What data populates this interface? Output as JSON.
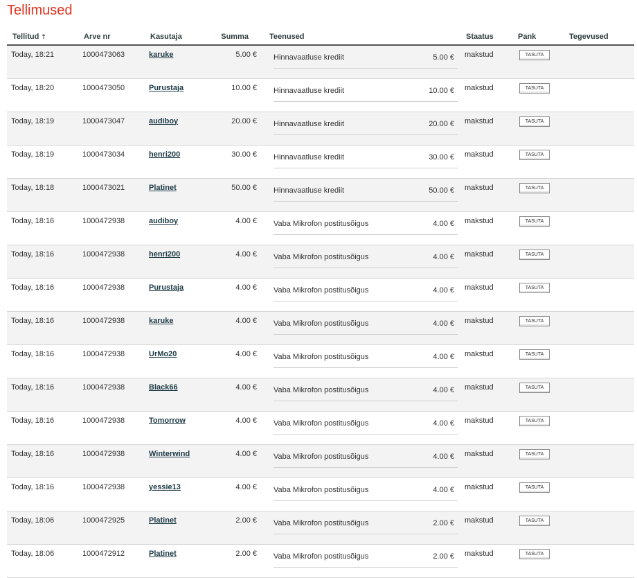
{
  "page": {
    "title": "Tellimused"
  },
  "columns": {
    "ordered": "Tellitud",
    "invoice": "Arve nr",
    "user": "Kasutaja",
    "sum": "Summa",
    "services": "Teenused",
    "status": "Staatus",
    "bank": "Pank",
    "actions": "Tegevused"
  },
  "rows": [
    {
      "date": "Today, 18:21",
      "invoice": "1000473063",
      "user": "karuke",
      "sum": "5.00 €",
      "service": "Hinnavaatluse krediit",
      "service_price": "5.00 €",
      "status": "makstud",
      "pay_label": "TASUTA"
    },
    {
      "date": "Today, 18:20",
      "invoice": "1000473050",
      "user": "Purustaja",
      "sum": "10.00 €",
      "service": "Hinnavaatluse krediit",
      "service_price": "10.00 €",
      "status": "makstud",
      "pay_label": "TASUTA"
    },
    {
      "date": "Today, 18:19",
      "invoice": "1000473047",
      "user": "audiboy",
      "sum": "20.00 €",
      "service": "Hinnavaatluse krediit",
      "service_price": "20.00 €",
      "status": "makstud",
      "pay_label": "TASUTA"
    },
    {
      "date": "Today, 18:19",
      "invoice": "1000473034",
      "user": "henri200",
      "sum": "30.00 €",
      "service": "Hinnavaatluse krediit",
      "service_price": "30.00 €",
      "status": "makstud",
      "pay_label": "TASUTA"
    },
    {
      "date": "Today, 18:18",
      "invoice": "1000473021",
      "user": "Platinet",
      "sum": "50.00 €",
      "service": "Hinnavaatluse krediit",
      "service_price": "50.00 €",
      "status": "makstud",
      "pay_label": "TASUTA"
    },
    {
      "date": "Today, 18:16",
      "invoice": "1000472938",
      "user": "audiboy",
      "sum": "4.00 €",
      "service": "Vaba Mikrofon postitusõigus",
      "service_price": "4.00 €",
      "status": "makstud",
      "pay_label": "TASUTA"
    },
    {
      "date": "Today, 18:16",
      "invoice": "1000472938",
      "user": "henri200",
      "sum": "4.00 €",
      "service": "Vaba Mikrofon postitusõigus",
      "service_price": "4.00 €",
      "status": "makstud",
      "pay_label": "TASUTA"
    },
    {
      "date": "Today, 18:16",
      "invoice": "1000472938",
      "user": "Purustaja",
      "sum": "4.00 €",
      "service": "Vaba Mikrofon postitusõigus",
      "service_price": "4.00 €",
      "status": "makstud",
      "pay_label": "TASUTA"
    },
    {
      "date": "Today, 18:16",
      "invoice": "1000472938",
      "user": "karuke",
      "sum": "4.00 €",
      "service": "Vaba Mikrofon postitusõigus",
      "service_price": "4.00 €",
      "status": "makstud",
      "pay_label": "TASUTA"
    },
    {
      "date": "Today, 18:16",
      "invoice": "1000472938",
      "user": "UrMo20",
      "sum": "4.00 €",
      "service": "Vaba Mikrofon postitusõigus",
      "service_price": "4.00 €",
      "status": "makstud",
      "pay_label": "TASUTA"
    },
    {
      "date": "Today, 18:16",
      "invoice": "1000472938",
      "user": "Black66",
      "sum": "4.00 €",
      "service": "Vaba Mikrofon postitusõigus",
      "service_price": "4.00 €",
      "status": "makstud",
      "pay_label": "TASUTA"
    },
    {
      "date": "Today, 18:16",
      "invoice": "1000472938",
      "user": "Tomorrow",
      "sum": "4.00 €",
      "service": "Vaba Mikrofon postitusõigus",
      "service_price": "4.00 €",
      "status": "makstud",
      "pay_label": "TASUTA"
    },
    {
      "date": "Today, 18:16",
      "invoice": "1000472938",
      "user": "Winterwind",
      "sum": "4.00 €",
      "service": "Vaba Mikrofon postitusõigus",
      "service_price": "4.00 €",
      "status": "makstud",
      "pay_label": "TASUTA"
    },
    {
      "date": "Today, 18:16",
      "invoice": "1000472938",
      "user": "yessie13",
      "sum": "4.00 €",
      "service": "Vaba Mikrofon postitusõigus",
      "service_price": "4.00 €",
      "status": "makstud",
      "pay_label": "TASUTA"
    },
    {
      "date": "Today, 18:06",
      "invoice": "1000472925",
      "user": "Platinet",
      "sum": "2.00 €",
      "service": "Vaba Mikrofon postitusõigus",
      "service_price": "2.00 €",
      "status": "makstud",
      "pay_label": "TASUTA"
    },
    {
      "date": "Today, 18:06",
      "invoice": "1000472912",
      "user": "Platinet",
      "sum": "2.00 €",
      "service": "Vaba Mikrofon postitusõigus",
      "service_price": "2.00 €",
      "status": "makstud",
      "pay_label": "TASUTA"
    }
  ]
}
